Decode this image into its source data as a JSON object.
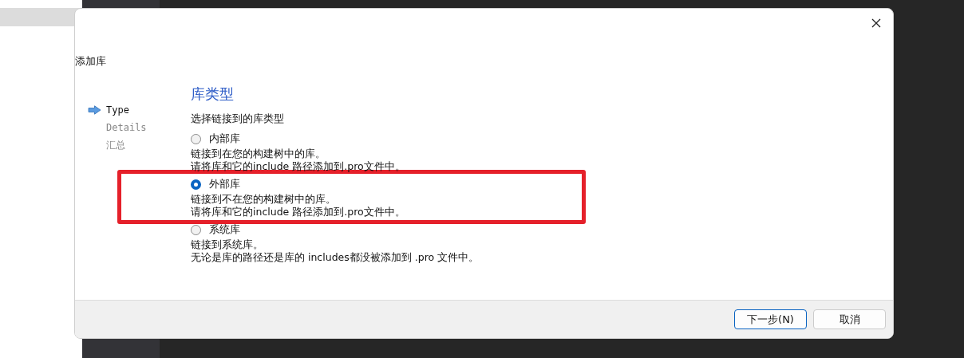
{
  "dialog": {
    "title": "添加库",
    "steps": [
      {
        "label": "Type",
        "selected": true
      },
      {
        "label": "Details",
        "selected": false
      },
      {
        "label": "汇总",
        "selected": false
      }
    ],
    "heading": "库类型",
    "prompt": "选择链接到的库类型",
    "options": [
      {
        "label": "内部库",
        "selected": false,
        "highlighted": false,
        "lines": [
          "链接到在您的构建树中的库。",
          "请将库和它的include 路径添加到.pro文件中。"
        ]
      },
      {
        "label": "外部库",
        "selected": true,
        "highlighted": true,
        "lines": [
          "链接到不在您的构建树中的库。",
          "请将库和它的include 路径添加到.pro文件中。"
        ]
      },
      {
        "label": "系统库",
        "selected": false,
        "highlighted": false,
        "lines": [
          "链接到系统库。",
          "无论是库的路径还是库的 includes都没被添加到 .pro 文件中。"
        ]
      }
    ],
    "buttons": [
      {
        "label": "下一步(N)",
        "default": true
      },
      {
        "label": "取消",
        "default": false
      }
    ]
  }
}
